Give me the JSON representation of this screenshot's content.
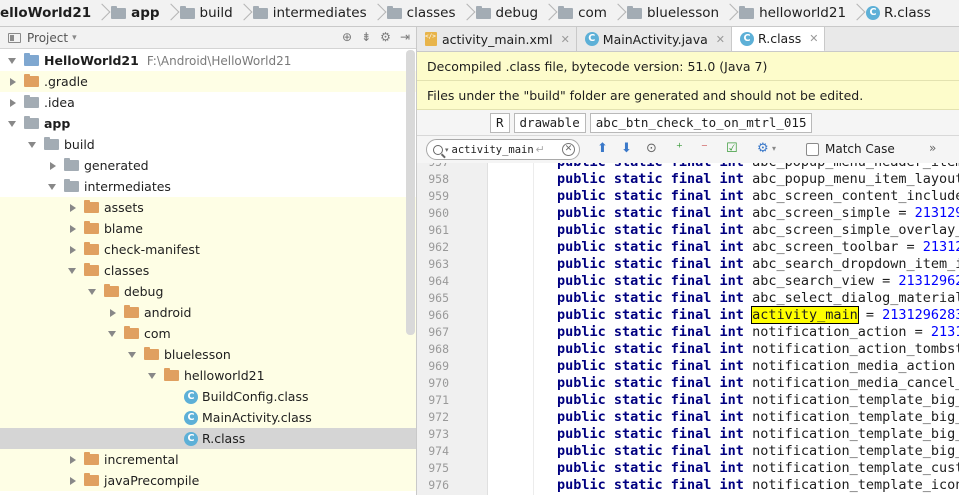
{
  "breadcrumb": [
    {
      "label": "elloWorld21",
      "icon": "project-folder-icon",
      "bold": true
    },
    {
      "label": "app",
      "icon": "module-folder-icon",
      "bold": true
    },
    {
      "label": "build",
      "icon": "folder-icon",
      "bold": false
    },
    {
      "label": "intermediates",
      "icon": "folder-icon",
      "bold": false
    },
    {
      "label": "classes",
      "icon": "folder-icon",
      "bold": false
    },
    {
      "label": "debug",
      "icon": "folder-icon",
      "bold": false
    },
    {
      "label": "com",
      "icon": "folder-icon",
      "bold": false
    },
    {
      "label": "bluelesson",
      "icon": "folder-icon",
      "bold": false
    },
    {
      "label": "helloworld21",
      "icon": "folder-icon",
      "bold": false
    },
    {
      "label": "R.class",
      "icon": "class-icon",
      "bold": false
    }
  ],
  "project_panel": {
    "title": "Project",
    "icons": [
      "sync-icon",
      "collapse-all-icon",
      "settings-icon",
      "hide-panel-icon"
    ]
  },
  "tree": [
    {
      "label": "HelloWorld21",
      "path": "F:\\Android\\HelloWorld21",
      "depth": 0,
      "state": "expanded",
      "icon": "project",
      "bold": true,
      "hl": false,
      "sel": false
    },
    {
      "label": ".gradle",
      "path": "",
      "depth": 0,
      "state": "collapsed",
      "icon": "orange",
      "bold": false,
      "hl": true,
      "sel": false
    },
    {
      "label": ".idea",
      "path": "",
      "depth": 0,
      "state": "collapsed",
      "icon": "gray",
      "bold": false,
      "hl": false,
      "sel": false
    },
    {
      "label": "app",
      "path": "",
      "depth": 0,
      "state": "expanded",
      "icon": "module",
      "bold": true,
      "hl": false,
      "sel": false
    },
    {
      "label": "build",
      "path": "",
      "depth": 1,
      "state": "expanded",
      "icon": "gray",
      "bold": false,
      "hl": false,
      "sel": false
    },
    {
      "label": "generated",
      "path": "",
      "depth": 2,
      "state": "collapsed",
      "icon": "gray",
      "bold": false,
      "hl": false,
      "sel": false
    },
    {
      "label": "intermediates",
      "path": "",
      "depth": 2,
      "state": "expanded",
      "icon": "gray",
      "bold": false,
      "hl": false,
      "sel": false
    },
    {
      "label": "assets",
      "path": "",
      "depth": 3,
      "state": "collapsed",
      "icon": "orange",
      "bold": false,
      "hl": true,
      "sel": false
    },
    {
      "label": "blame",
      "path": "",
      "depth": 3,
      "state": "collapsed",
      "icon": "orange",
      "bold": false,
      "hl": true,
      "sel": false
    },
    {
      "label": "check-manifest",
      "path": "",
      "depth": 3,
      "state": "collapsed",
      "icon": "orange",
      "bold": false,
      "hl": true,
      "sel": false
    },
    {
      "label": "classes",
      "path": "",
      "depth": 3,
      "state": "expanded",
      "icon": "orange",
      "bold": false,
      "hl": true,
      "sel": false
    },
    {
      "label": "debug",
      "path": "",
      "depth": 4,
      "state": "expanded",
      "icon": "orange",
      "bold": false,
      "hl": true,
      "sel": false
    },
    {
      "label": "android",
      "path": "",
      "depth": 5,
      "state": "collapsed",
      "icon": "orange",
      "bold": false,
      "hl": true,
      "sel": false
    },
    {
      "label": "com",
      "path": "",
      "depth": 5,
      "state": "expanded",
      "icon": "orange",
      "bold": false,
      "hl": true,
      "sel": false
    },
    {
      "label": "bluelesson",
      "path": "",
      "depth": 6,
      "state": "expanded",
      "icon": "orange",
      "bold": false,
      "hl": true,
      "sel": false
    },
    {
      "label": "helloworld21",
      "path": "",
      "depth": 7,
      "state": "expanded",
      "icon": "orange",
      "bold": false,
      "hl": true,
      "sel": false
    },
    {
      "label": "BuildConfig.class",
      "path": "",
      "depth": 8,
      "state": "none",
      "icon": "class",
      "bold": false,
      "hl": true,
      "sel": false
    },
    {
      "label": "MainActivity.class",
      "path": "",
      "depth": 8,
      "state": "none",
      "icon": "class",
      "bold": false,
      "hl": true,
      "sel": false
    },
    {
      "label": "R.class",
      "path": "",
      "depth": 8,
      "state": "none",
      "icon": "class",
      "bold": false,
      "hl": false,
      "sel": true
    },
    {
      "label": "incremental",
      "path": "",
      "depth": 3,
      "state": "collapsed",
      "icon": "orange",
      "bold": false,
      "hl": true,
      "sel": false
    },
    {
      "label": "javaPrecompile",
      "path": "",
      "depth": 3,
      "state": "collapsed",
      "icon": "orange",
      "bold": false,
      "hl": true,
      "sel": false
    }
  ],
  "tabs": [
    {
      "label": "activity_main.xml",
      "icon": "xml-file-icon",
      "active": false
    },
    {
      "label": "MainActivity.java",
      "icon": "class-icon",
      "active": false
    },
    {
      "label": "R.class",
      "icon": "class-icon",
      "active": true
    }
  ],
  "banners": {
    "decompiled": "Decompiled .class file, bytecode version: 51.0 (Java 7)",
    "build_folder": "Files under the \"build\" folder are generated and should not be edited."
  },
  "nav_path": [
    "R",
    "drawable",
    "abc_btn_check_to_on_mtrl_015"
  ],
  "search": {
    "value": "activity_main",
    "match_case_label": "Match Case",
    "match_case_checked": false
  },
  "code_lines": [
    {
      "n": "957",
      "name": "abc_popup_menu_header_item_",
      "val": "",
      "hit": false
    },
    {
      "n": "958",
      "name": "abc_popup_menu_item_layout",
      "val": "",
      "hit": false
    },
    {
      "n": "959",
      "name": "abc_screen_content_include",
      "val": "",
      "hit": false
    },
    {
      "n": "960",
      "name": "abc_screen_simple",
      "val": "2131296",
      "hit": false
    },
    {
      "n": "961",
      "name": "abc_screen_simple_overlay_a",
      "val": "",
      "hit": false
    },
    {
      "n": "962",
      "name": "abc_screen_toolbar",
      "val": "213129",
      "hit": false
    },
    {
      "n": "963",
      "name": "abc_search_dropdown_item_ic",
      "val": "",
      "hit": false
    },
    {
      "n": "964",
      "name": "abc_search_view",
      "val": "213129628",
      "hit": false
    },
    {
      "n": "965",
      "name": "abc_select_dialog_material",
      "val": "",
      "hit": false
    },
    {
      "n": "966",
      "name": "activity_main",
      "val": "2131296283",
      "hit": true
    },
    {
      "n": "967",
      "name": "notification_action",
      "val": "2131",
      "hit": false
    },
    {
      "n": "968",
      "name": "notification_action_tombsto",
      "val": "",
      "hit": false
    },
    {
      "n": "969",
      "name": "notification_media_action",
      "val": "",
      "hit": false
    },
    {
      "n": "970",
      "name": "notification_media_cancel_a",
      "val": "",
      "hit": false
    },
    {
      "n": "971",
      "name": "notification_template_big_m",
      "val": "",
      "hit": false
    },
    {
      "n": "972",
      "name": "notification_template_big_m",
      "val": "",
      "hit": false
    },
    {
      "n": "973",
      "name": "notification_template_big_m",
      "val": "",
      "hit": false
    },
    {
      "n": "974",
      "name": "notification_template_big_m",
      "val": "",
      "hit": false
    },
    {
      "n": "975",
      "name": "notification_template_custo",
      "val": "",
      "hit": false
    },
    {
      "n": "976",
      "name": "notification_template_icon",
      "val": "",
      "hit": false
    }
  ],
  "code_prefix": "public static final int"
}
